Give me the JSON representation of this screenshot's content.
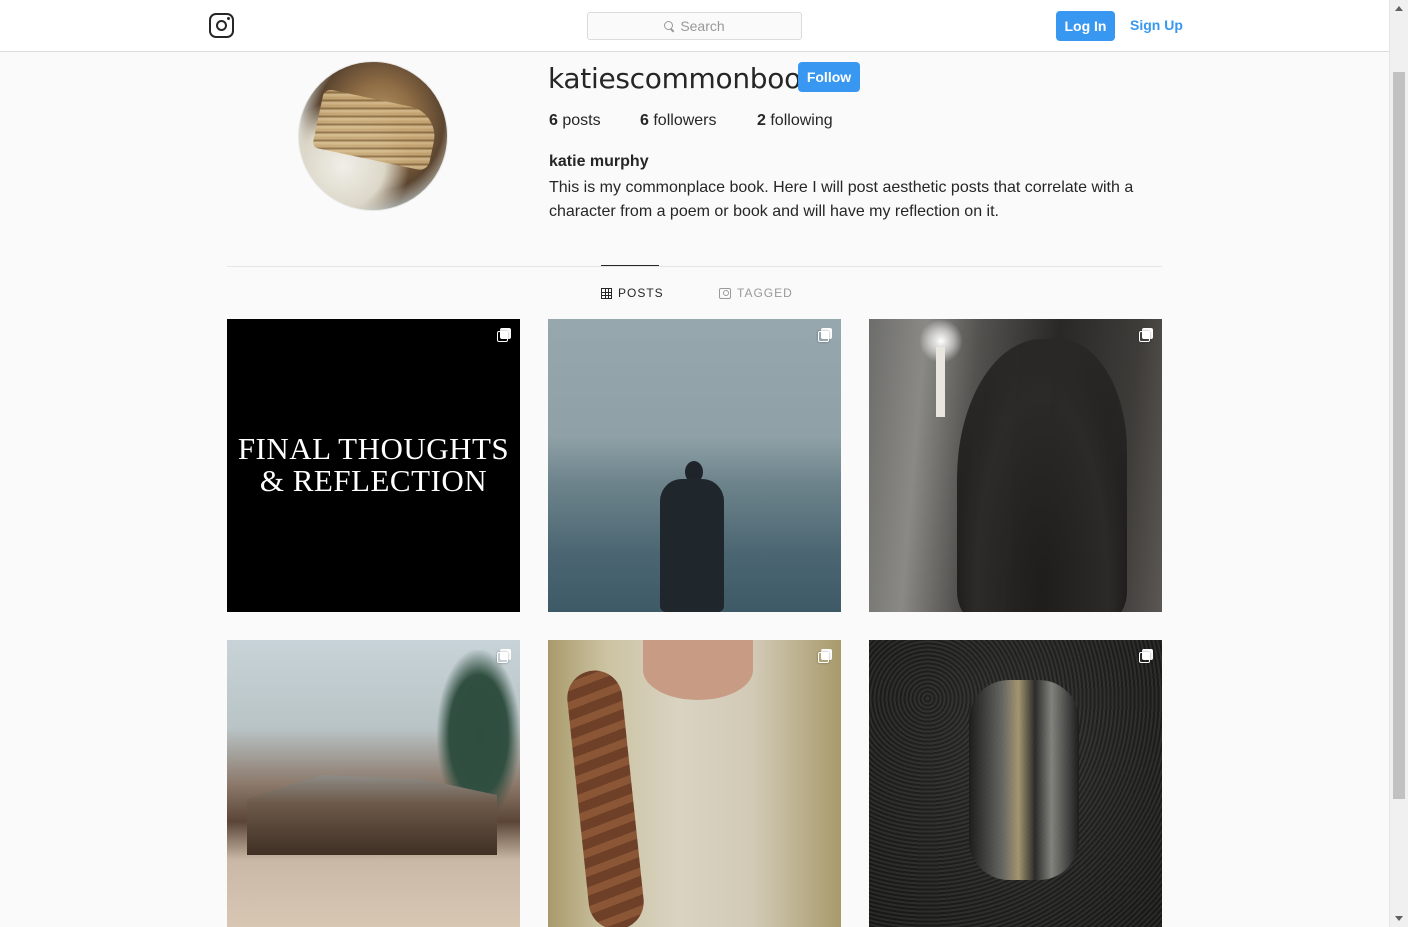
{
  "header": {
    "logo_icon": "instagram-logo-icon",
    "search_placeholder": "Search",
    "login_label": "Log In",
    "signup_label": "Sign Up"
  },
  "profile": {
    "username": "katiescommonbook",
    "follow_label": "Follow",
    "posts_count": "6",
    "posts_label": "posts",
    "followers_count": "6",
    "followers_label": "followers",
    "following_count": "2",
    "following_label": "following",
    "full_name": "katie murphy",
    "bio": "This is my commonplace book. Here I will post aesthetic posts that correlate with a character from a poem or book and will have my reflection on it."
  },
  "tabs": [
    {
      "label": "POSTS",
      "icon": "grid-icon",
      "active": true
    },
    {
      "label": "TAGGED",
      "icon": "tagged-icon",
      "active": false
    }
  ],
  "posts": [
    {
      "caption_text_line1": "FINAL THOUGHTS",
      "caption_text_line2": "& REFLECTION",
      "multi": true
    },
    {
      "description_icon": "man-by-sea-image",
      "multi": true
    },
    {
      "description_icon": "woman-with-candle-image",
      "multi": true
    },
    {
      "description_icon": "old-shack-image",
      "multi": true
    },
    {
      "description_icon": "braided-hair-image",
      "multi": true
    },
    {
      "description_icon": "armored-knight-image",
      "multi": true
    }
  ],
  "colors": {
    "accent": "#3897f0",
    "text": "#262626",
    "muted": "#999999",
    "background": "#fafafa"
  }
}
